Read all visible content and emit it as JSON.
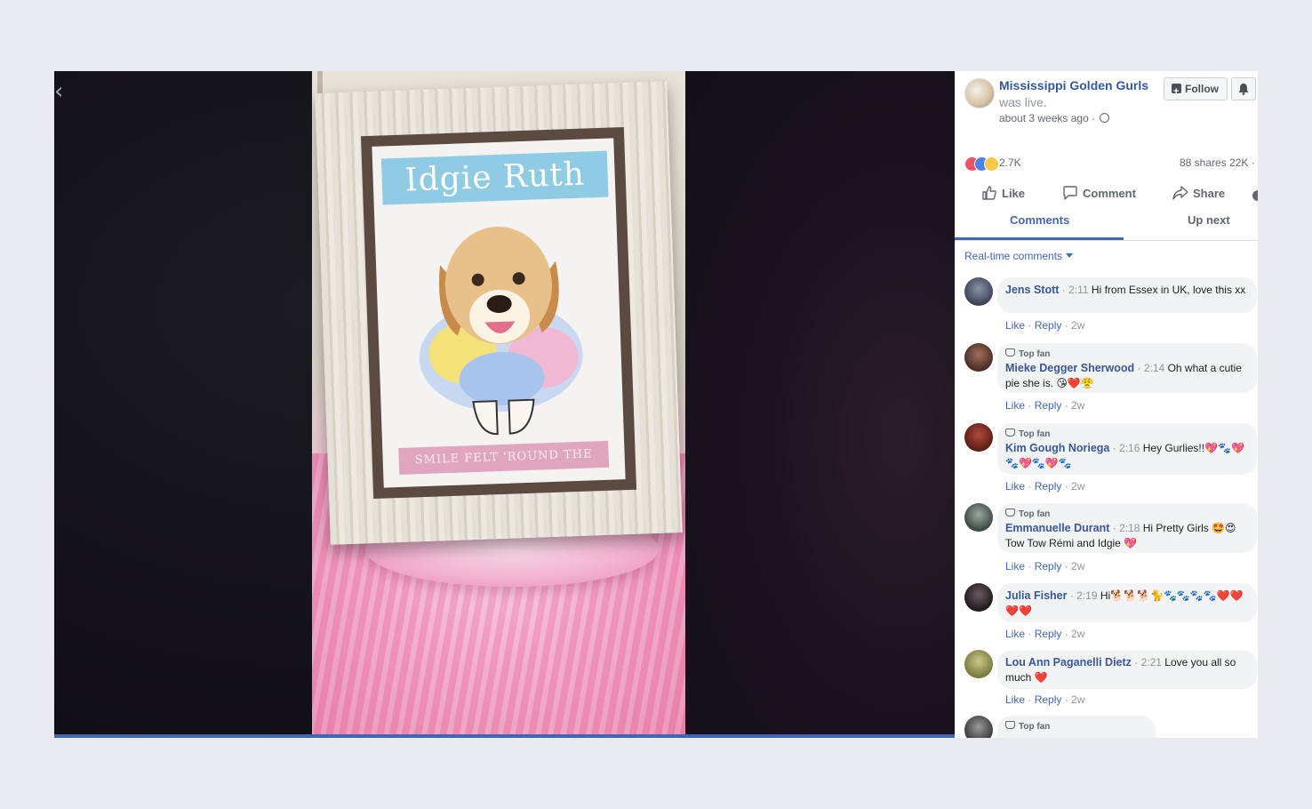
{
  "video": {
    "back_label": "‹",
    "art_title": "Idgie Ruth",
    "art_footer": "SMILE FELT 'ROUND THE WORLD"
  },
  "post": {
    "page_name": "Mississippi Golden Gurls",
    "status": "was live.",
    "time": "about 3 weeks ago · ",
    "follow_label": "Follow",
    "reaction_count": "2.7K",
    "shares": "88 shares  22K ·"
  },
  "actions": {
    "like": "Like",
    "comment": "Comment",
    "share": "Share"
  },
  "tabs": {
    "comments": "Comments",
    "up_next": "Up next"
  },
  "comments_filter": "Real-time comments",
  "comments": [
    {
      "author": "Jens Stott",
      "ts": "· 2:11",
      "text": "Hi from Essex in UK, love this xx",
      "top_fan": "",
      "like": "Like",
      "reply": "Reply",
      "age": "2w"
    },
    {
      "author": "Mieke Degger Sherwood",
      "ts": "· 2:14",
      "text": "Oh what a cutie pie she is. 😘❤️😤",
      "top_fan": "Top fan",
      "like": "Like",
      "reply": "Reply",
      "age": "2w"
    },
    {
      "author": "Kim Gough Noriega",
      "ts": "· 2:16",
      "text": "Hey Gurlies!!💖🐾💖🐾💖🐾💖🐾",
      "top_fan": "Top fan",
      "like": "Like",
      "reply": "Reply",
      "age": "2w"
    },
    {
      "author": "Emmanuelle Durant",
      "ts": "· 2:18",
      "text": "Hi Pretty Girls 🤩😍 Tow Tow Rémi and Idgie 💖",
      "top_fan": "Top fan",
      "like": "Like",
      "reply": "Reply",
      "age": "2w"
    },
    {
      "author": "Julia Fisher",
      "ts": "· 2:19",
      "text": "Hi🐕🐕🐕🐈🐾🐾🐾🐾❤️❤️❤️❤️",
      "top_fan": "",
      "like": "Like",
      "reply": "Reply",
      "age": "2w"
    },
    {
      "author": "Lou Ann Paganelli Dietz",
      "ts": "· 2:21",
      "text": "Love you all so much ❤️",
      "top_fan": "",
      "like": "Like",
      "reply": "Reply",
      "age": "2w"
    },
    {
      "author": "",
      "ts": "",
      "text": "",
      "top_fan": "Top fan",
      "like": "",
      "reply": "",
      "age": ""
    }
  ],
  "colors": {
    "accent": "#4267b2",
    "link": "#385898",
    "page_bg": "#e9ebee"
  }
}
